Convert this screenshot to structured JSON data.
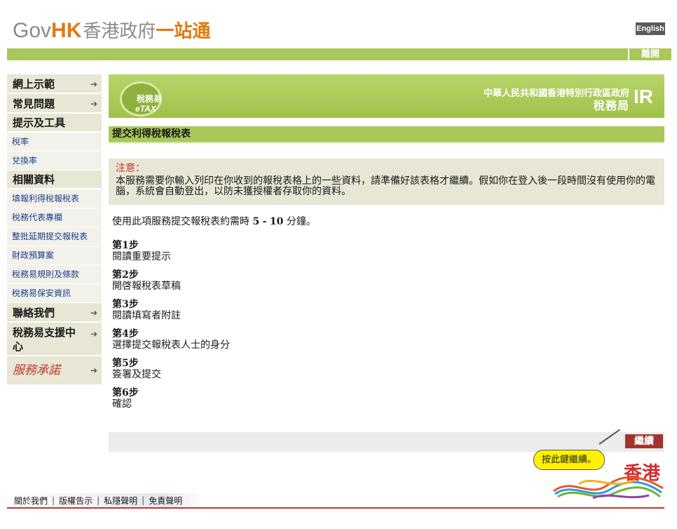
{
  "header": {
    "logo": {
      "gov": "Gov",
      "hk": "HK",
      "zh_part1": "香港政府",
      "zh_part2": "一站通"
    },
    "language_button": "English",
    "logout_button": "離開"
  },
  "sidebar": {
    "demo": "網上示範",
    "faq": "常見問題",
    "tips_heading": "提示及工具",
    "tips_items": [
      "稅率",
      "兌換率"
    ],
    "related_heading": "相關資料",
    "related_items": [
      "填報利得稅報稅表",
      "稅務代表專欄",
      "整批延期提交報稅表",
      "財政預算案",
      "稅務易規則及條款",
      "稅務易保安資訊"
    ],
    "contact": "聯絡我們",
    "support": "稅務易支援中心",
    "pledge": "服務承諾",
    "arrow": "➔"
  },
  "banner": {
    "etax_zh": "稅務易",
    "etax_en": "eTAX",
    "dept_line1": "中華人民共和國香港特別行政區政府",
    "dept_line2": "稅務局",
    "ir_logo": "IR"
  },
  "main": {
    "title": "提交利得稅報稅表",
    "notice_label": "注意：",
    "notice_text": "本服務需要你輸入列印在你收到的報稅表格上的一些資料，請準備好該表格才繼續。假如你在登入後一段時間沒有使用你的電腦，系統會自動登出，以防未獲授權者存取你的資料。",
    "duration_prefix": "使用此項服務提交報稅表約需時",
    "duration_min": "5",
    "duration_dash": "-",
    "duration_max": "10",
    "duration_suffix": "分鐘。",
    "steps": [
      {
        "no": "第1步",
        "text": "閱讀重要提示"
      },
      {
        "no": "第2步",
        "text": "開啓報稅表草稿"
      },
      {
        "no": "第3步",
        "text": "閱讀填寫者附註"
      },
      {
        "no": "第4步",
        "text": "選擇提交報稅表人士的身分"
      },
      {
        "no": "第5步",
        "text": "簽署及提交"
      },
      {
        "no": "第6步",
        "text": "確認"
      }
    ],
    "continue_button": "繼續",
    "tooltip": "按此鍵繼續。"
  },
  "brand": {
    "hk_text": "香港"
  },
  "footer": {
    "links": [
      "關於我們",
      "版權告示",
      "私隱聲明",
      "免責聲明"
    ],
    "separator": "|"
  },
  "colors": {
    "accent_green": "#a9c75a",
    "notice_bg": "#e8e6d4",
    "continue_red": "#a0352d",
    "notice_red": "#c0392b",
    "link_blue": "#1a3e8c"
  }
}
